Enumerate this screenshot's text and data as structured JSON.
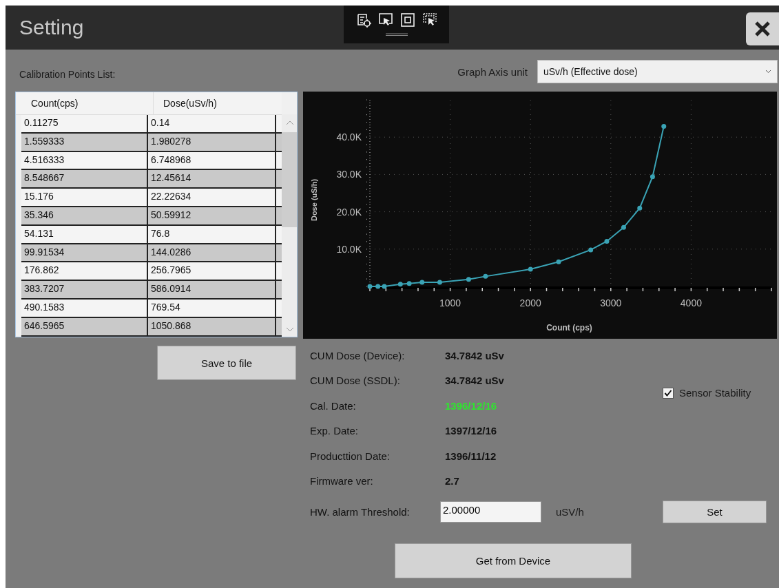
{
  "window": {
    "title": "Setting"
  },
  "calibration": {
    "label": "Calibration Points List:",
    "columns": [
      "Count(cps)",
      "Dose(uSv/h)"
    ],
    "rows": [
      [
        "0.11275",
        "0.14"
      ],
      [
        "1.559333",
        "1.980278"
      ],
      [
        "4.516333",
        "6.748968"
      ],
      [
        "8.548667",
        "12.45614"
      ],
      [
        "15.176",
        "22.22634"
      ],
      [
        "35.346",
        "50.59912"
      ],
      [
        "54.131",
        "76.8"
      ],
      [
        "99.91534",
        "144.0286"
      ],
      [
        "176.862",
        "256.7965"
      ],
      [
        "383.7207",
        "586.0914"
      ],
      [
        "490.1583",
        "769.54"
      ],
      [
        "646.5965",
        "1050.868"
      ]
    ]
  },
  "graph_axis": {
    "label": "Graph Axis unit",
    "value": "uSv/h (Effective dose)"
  },
  "chart": {
    "chart_data": {
      "type": "line",
      "xlabel": "Count (cps)",
      "ylabel": "Dose (uS/h)",
      "x": [
        0,
        100,
        180,
        380,
        490,
        650,
        870,
        1230,
        1440,
        2000,
        2350,
        2750,
        2950,
        3160,
        3360,
        3520,
        3660
      ],
      "series": [
        {
          "color": "#3aa3b5",
          "marker": true,
          "values": [
            0,
            0,
            0,
            600,
            800,
            1100,
            1100,
            1900,
            2700,
            4600,
            6600,
            9800,
            12100,
            15800,
            21000,
            29400,
            42900
          ]
        }
      ],
      "grid": true,
      "xlim": [
        0,
        5000
      ],
      "ylim": [
        0,
        50000
      ],
      "xticks": [
        1000,
        2000,
        3000,
        4000
      ],
      "yticks": [
        {
          "value": 10000,
          "label": "10.0K"
        },
        {
          "value": 20000,
          "label": "20.0K"
        },
        {
          "value": 30000,
          "label": "30.0K"
        },
        {
          "value": 40000,
          "label": "40.0K"
        }
      ]
    }
  },
  "save_button": "Save to file",
  "info": [
    {
      "label": "CUM Dose (Device):",
      "value": "34.7842 uSv",
      "highlight": false
    },
    {
      "label": "CUM Dose (SSDL):",
      "value": "34.7842 uSv",
      "highlight": false
    },
    {
      "label": "Cal. Date:",
      "value": "1396/12/16",
      "highlight": true
    },
    {
      "label": "Exp. Date:",
      "value": "1397/12/16",
      "highlight": false
    },
    {
      "label": "Producttion Date:",
      "value": "1396/11/12",
      "highlight": false
    },
    {
      "label": "Firmware ver:",
      "value": "2.7",
      "highlight": false
    }
  ],
  "sensor_stability": {
    "label": "Sensor Stability",
    "checked": true
  },
  "threshold": {
    "label": "HW. alarm Threshold:",
    "value": "2.00000",
    "unit": "uSV/h"
  },
  "set_button": "Set",
  "get_button": "Get from Device"
}
